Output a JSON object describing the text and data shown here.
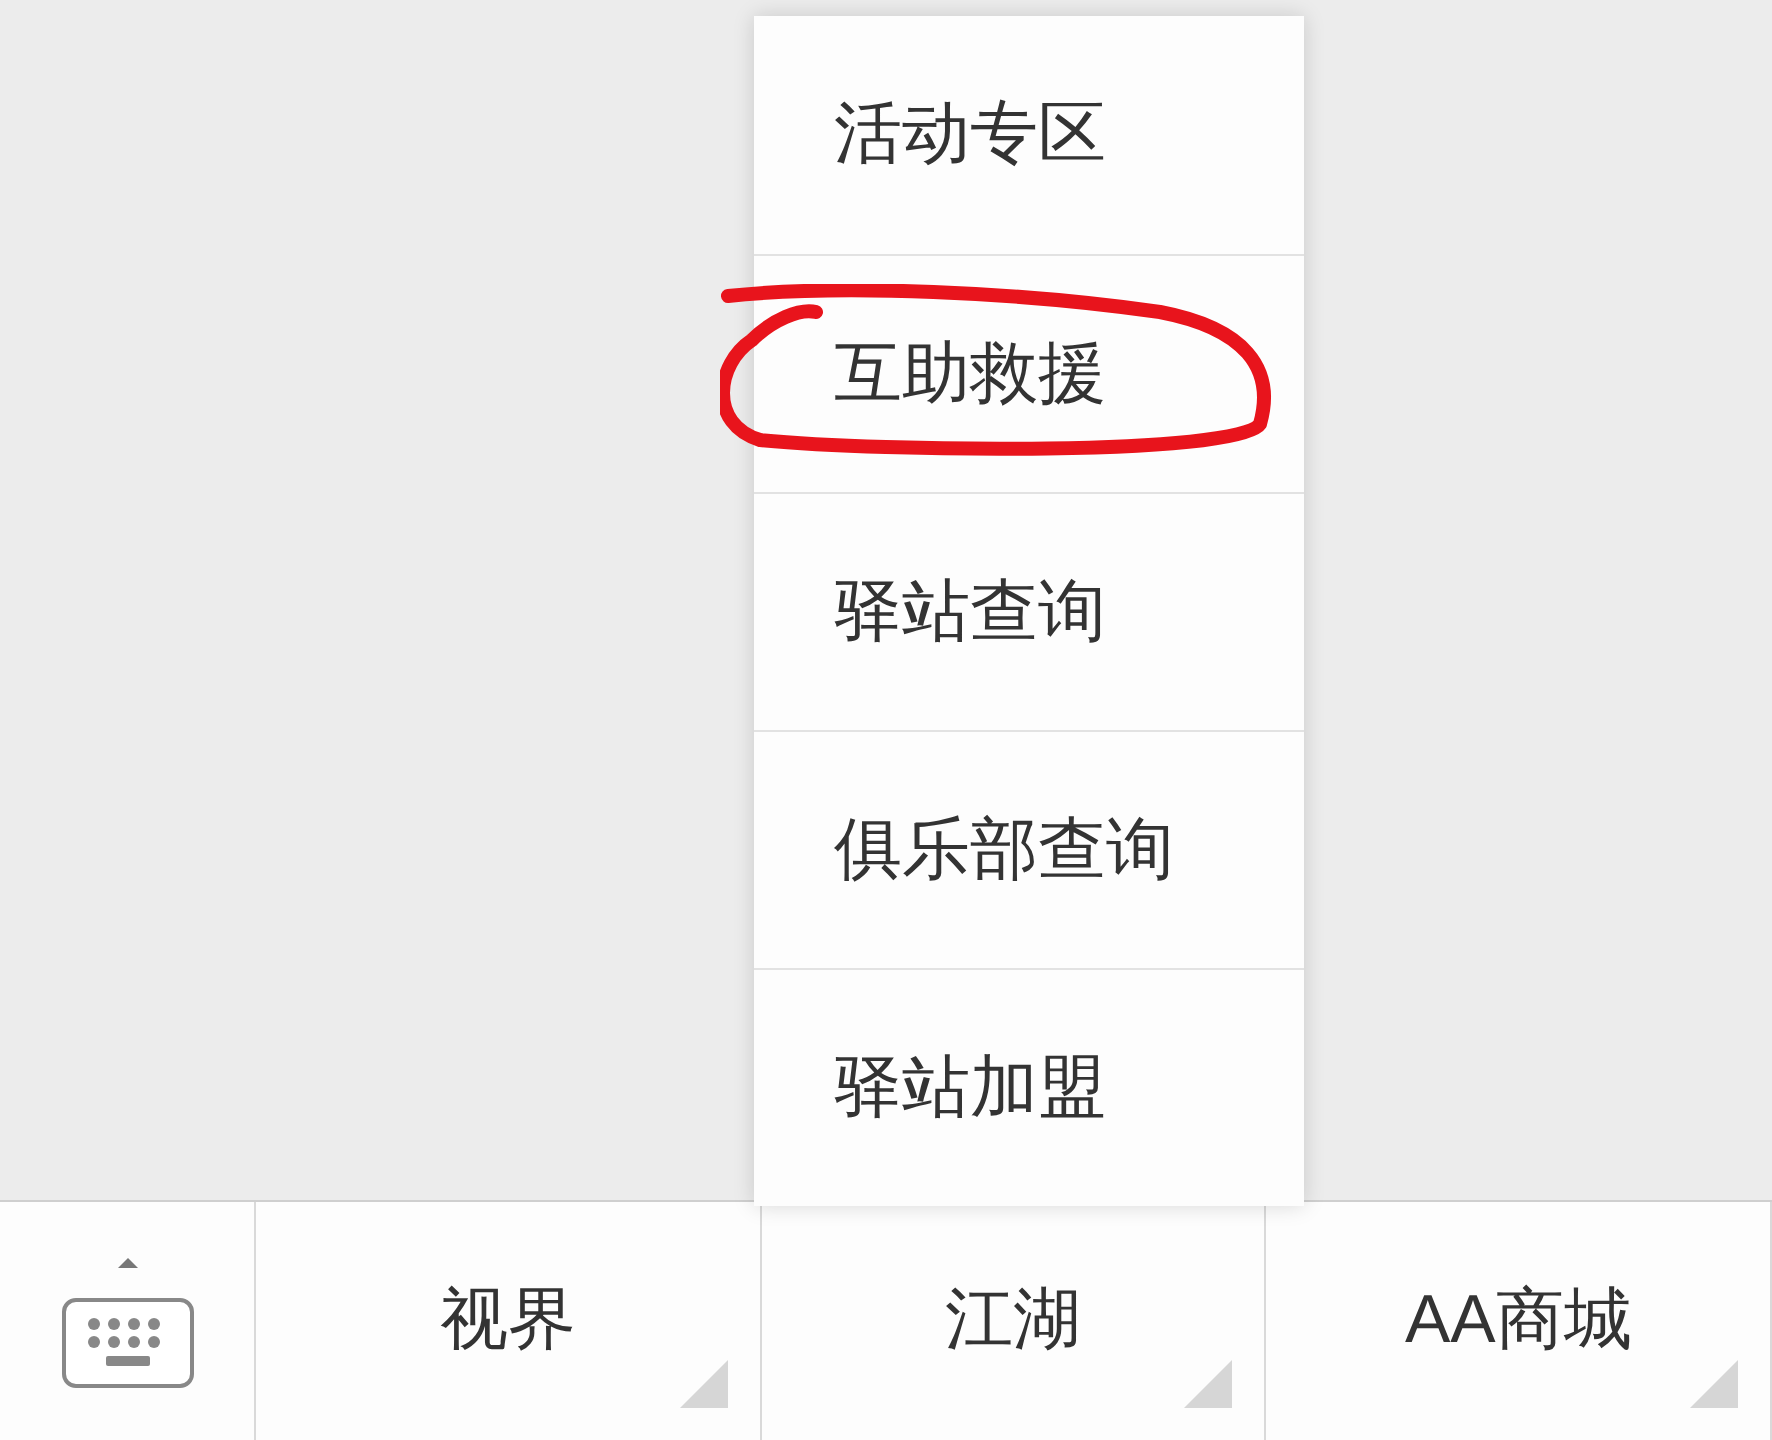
{
  "menu": {
    "items": [
      {
        "label": "活动专区",
        "annotated": false
      },
      {
        "label": "互助救援",
        "annotated": true
      },
      {
        "label": "驿站查询",
        "annotated": false
      },
      {
        "label": "俱乐部查询",
        "annotated": false
      },
      {
        "label": "驿站加盟",
        "annotated": false
      }
    ]
  },
  "bottom_bar": {
    "buttons": [
      {
        "label": "视界"
      },
      {
        "label": "江湖"
      },
      {
        "label": "AA商城"
      }
    ]
  }
}
